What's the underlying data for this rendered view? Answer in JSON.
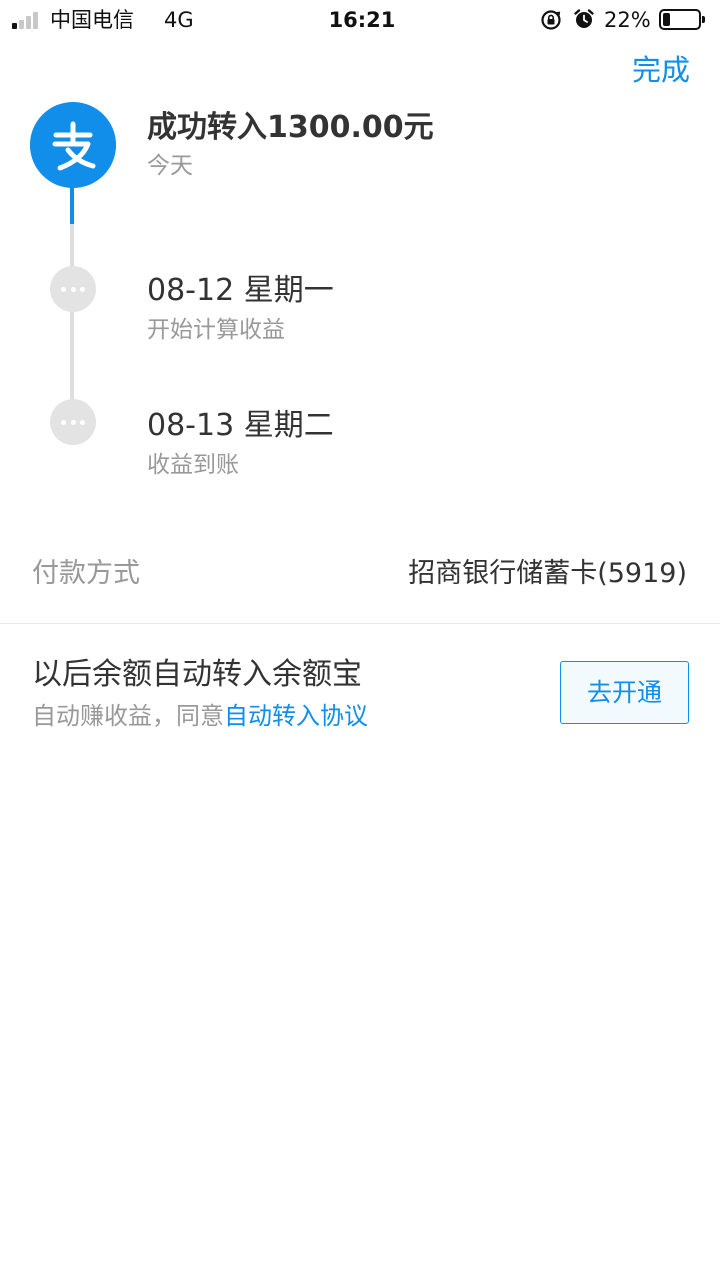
{
  "status_bar": {
    "carrier": "中国电信",
    "network": "4G",
    "time": "16:21",
    "battery": "22%",
    "battery_level": 0.22,
    "signal_bars_on": 1,
    "icons": [
      "signal-icon",
      "orientation-lock-icon",
      "alarm-icon",
      "battery-icon"
    ]
  },
  "header": {
    "done_label": "完成"
  },
  "timeline": {
    "steps": [
      {
        "title": "成功转入1300.00元",
        "subtitle": "今天",
        "icon": "alipay-logo"
      },
      {
        "title": "08-12 星期一",
        "subtitle": "开始计算收益",
        "icon": "pending-dot-icon"
      },
      {
        "title": "08-13 星期二",
        "subtitle": "收益到账",
        "icon": "pending-dot-icon"
      }
    ]
  },
  "payment": {
    "label": "付款方式",
    "value": "招商银行储蓄卡(5919)"
  },
  "auto_transfer": {
    "title": "以后余额自动转入余额宝",
    "subtitle_prefix": "自动赚收益，同意",
    "agreement_link": "自动转入协议",
    "button_label": "去开通"
  },
  "colors": {
    "accent": "#108ee9",
    "text_primary": "#333333",
    "text_secondary": "#999999",
    "dot": "#e3e3e3"
  }
}
